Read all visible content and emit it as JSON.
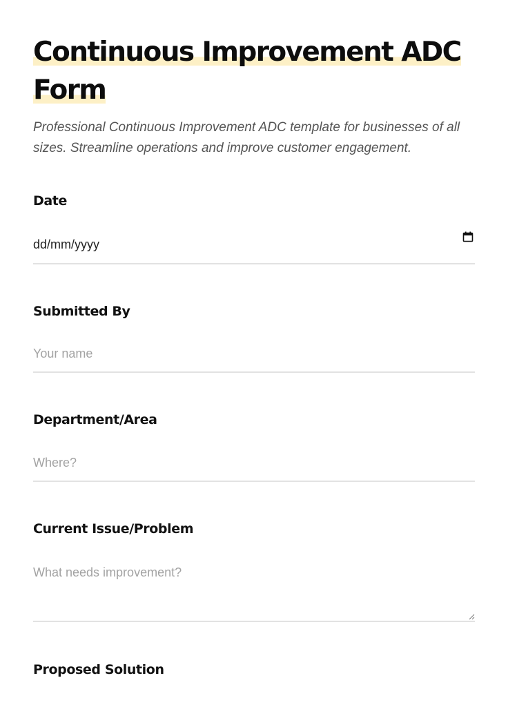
{
  "form": {
    "title_line1": "Continuous Improvement ADC",
    "title_line2": "Form",
    "subtitle": "Professional Continuous Improvement ADC template for businesses of all sizes. Streamline operations and improve customer engagement.",
    "fields": {
      "date": {
        "label": "Date",
        "placeholder": "dd/mm/yyyy",
        "icon": "calendar-icon"
      },
      "submitted_by": {
        "label": "Submitted By",
        "placeholder": "Your name"
      },
      "department": {
        "label": "Department/Area",
        "placeholder": "Where?"
      },
      "current_issue": {
        "label": "Current Issue/Problem",
        "placeholder": "What needs improvement?"
      },
      "proposed_solution": {
        "label": "Proposed Solution"
      }
    }
  },
  "colors": {
    "highlight": "#fdf0c6",
    "border": "#e2e2e2",
    "placeholder": "#a3a3a3"
  }
}
